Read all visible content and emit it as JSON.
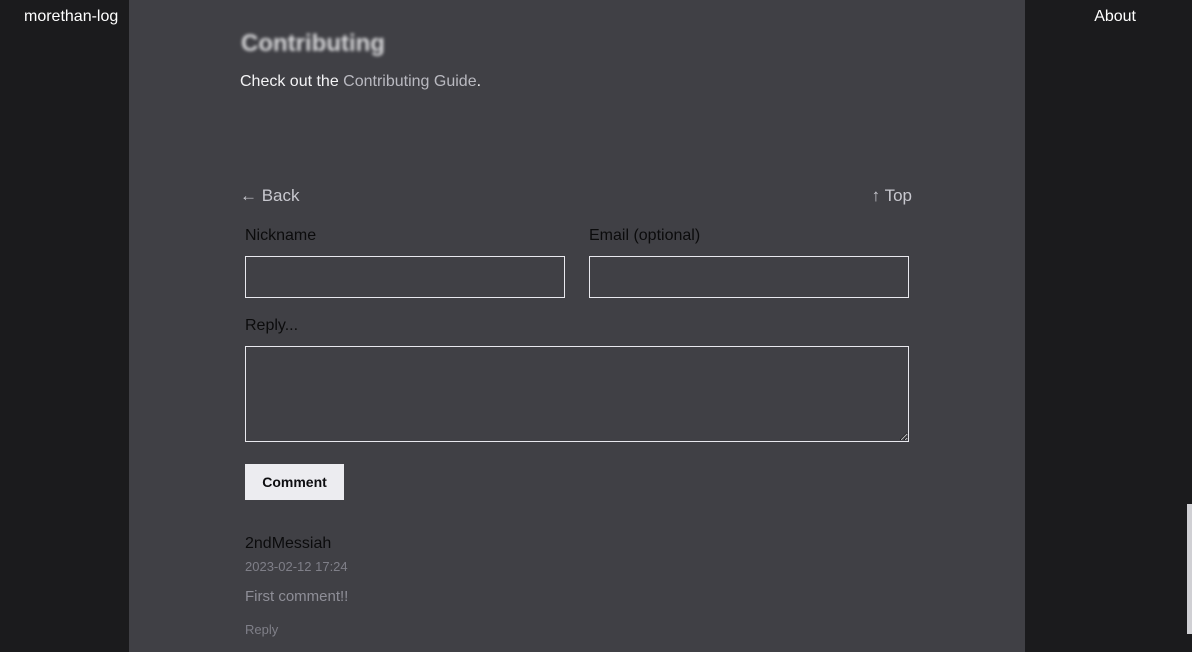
{
  "header": {
    "brand": "morethan-log",
    "about": "About"
  },
  "article": {
    "section_heading": "Contributing",
    "contrib_prefix": "Check out the ",
    "contrib_link": "Contributing Guide",
    "contrib_suffix": "."
  },
  "nav": {
    "back": "← Back",
    "top": "↑ Top"
  },
  "comment_form": {
    "nickname_label": "Nickname",
    "nickname_value": "",
    "email_label": "Email (optional)",
    "email_value": "",
    "reply_label": "Reply...",
    "reply_value": "",
    "submit_label": "Comment"
  },
  "comments": [
    {
      "author": "2ndMessiah",
      "date": "2023-02-12 17:24",
      "body": "First comment!!",
      "reply_label": "Reply"
    }
  ]
}
